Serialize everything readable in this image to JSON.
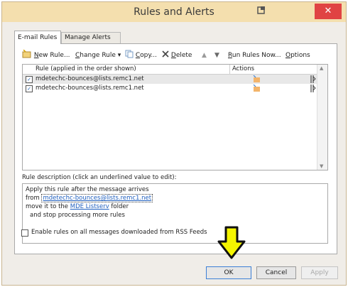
{
  "window": {
    "title": "Rules and Alerts",
    "close_glyph": "✕"
  },
  "tabs": [
    {
      "label": "E-mail Rules"
    },
    {
      "label": "Manage Alerts"
    }
  ],
  "toolbar": {
    "new_rule": {
      "hotkey": "N",
      "rest": "ew Rule..."
    },
    "change_rule": {
      "hotkey": "C",
      "rest": "hange Rule ▾"
    },
    "copy": {
      "hotkey": "C",
      "rest": "opy..."
    },
    "delete": {
      "hotkey": "D",
      "rest": "elete"
    },
    "run_rules": {
      "hotkey": "R",
      "rest": "un Rules Now..."
    },
    "options": {
      "hotkey": "O",
      "rest": "ptions"
    }
  },
  "grid": {
    "col_rule": "Rule (applied in the order shown)",
    "col_actions": "Actions",
    "rows": [
      {
        "name": "mdetechc-bounces@lists.remc1.net",
        "checked": true
      },
      {
        "name": "mdetechc-bounces@lists.remc1.net",
        "checked": true
      }
    ]
  },
  "description": {
    "label": "Rule description (click an underlined value to edit):",
    "line1": "Apply this rule after the message arrives",
    "line2_prefix": "from ",
    "line2_link": "mdetechc-bounces@lists.remc1.net",
    "line3_prefix": "move it to the ",
    "line3_link": "MDE Listserv",
    "line3_suffix": " folder",
    "line4": "and stop processing more rules"
  },
  "rss_checkbox": {
    "label": "Enable rules on all messages downloaded from RSS Feeds",
    "checked": false
  },
  "buttons": {
    "ok": "OK",
    "cancel": "Cancel",
    "apply": "Apply"
  },
  "colors": {
    "titlebar": "#f4dfae",
    "close": "#e04343",
    "arrow": "#f5f500",
    "link": "#1f5fbf"
  }
}
